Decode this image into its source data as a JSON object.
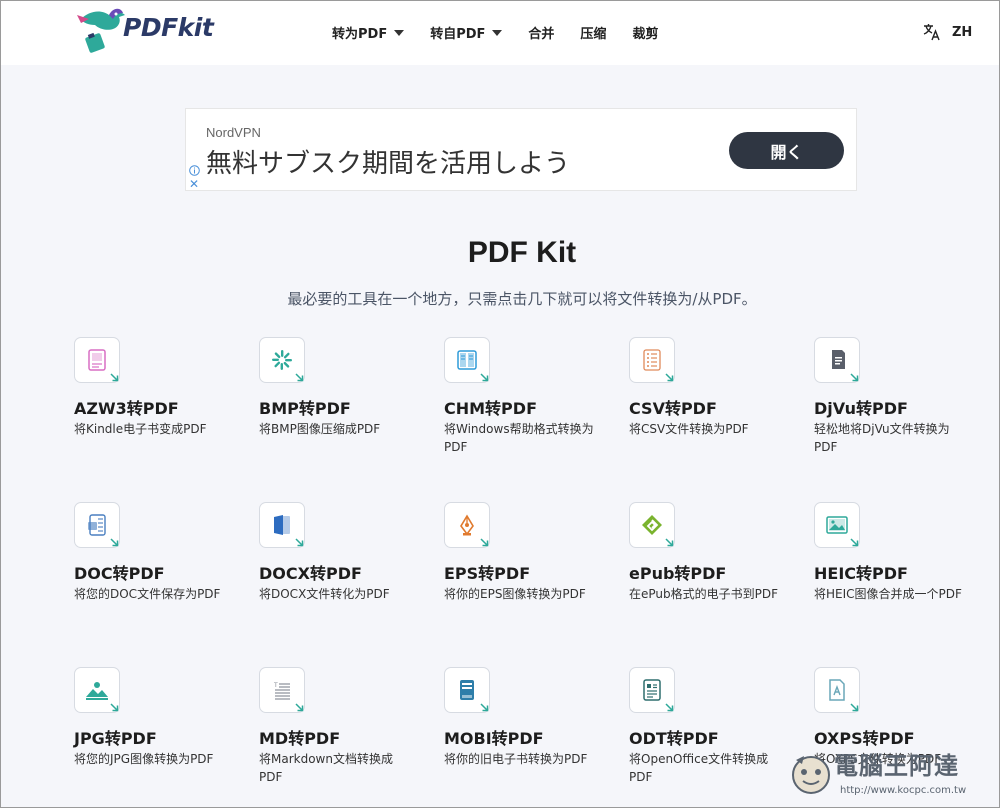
{
  "header": {
    "logo_text": "PDFkit",
    "nav": [
      {
        "label": "转为PDF",
        "dropdown": true
      },
      {
        "label": "转自PDF",
        "dropdown": true
      },
      {
        "label": "合并",
        "dropdown": false
      },
      {
        "label": "压缩",
        "dropdown": false
      },
      {
        "label": "裁剪",
        "dropdown": false
      }
    ],
    "language": "ZH"
  },
  "ad": {
    "brand": "NordVPN",
    "headline": "無料サブスク期間を活用しよう",
    "cta": "開く",
    "close": "✕"
  },
  "main": {
    "title": "PDF Kit",
    "subtitle": "最必要的工具在一个地方，只需点击几下就可以将文件转换为/从PDF。",
    "tools": [
      {
        "name": "AZW3转PDF",
        "desc": "将Kindle电子书变成PDF",
        "icon": "azw3-icon",
        "color": "#d86fc4"
      },
      {
        "name": "BMP转PDF",
        "desc": "将BMP图像压缩成PDF",
        "icon": "bmp-icon",
        "color": "#2ea99a"
      },
      {
        "name": "CHM转PDF",
        "desc": "将Windows帮助格式转换为PDF",
        "icon": "chm-icon",
        "color": "#2f9bd8"
      },
      {
        "name": "CSV转PDF",
        "desc": "将CSV文件转换为PDF",
        "icon": "csv-icon",
        "color": "#e08a5a"
      },
      {
        "name": "DjVu转PDF",
        "desc": "轻松地将DjVu文件转换为PDF",
        "icon": "djvu-icon",
        "color": "#5a5f6a"
      },
      {
        "name": "DOC转PDF",
        "desc": "将您的DOC文件保存为PDF",
        "icon": "doc-icon",
        "color": "#4a7fc0"
      },
      {
        "name": "DOCX转PDF",
        "desc": "将DOCX文件转化为PDF",
        "icon": "docx-icon",
        "color": "#2d6cc0"
      },
      {
        "name": "EPS转PDF",
        "desc": "将你的EPS图像转换为PDF",
        "icon": "eps-icon",
        "color": "#e07a2e"
      },
      {
        "name": "ePub转PDF",
        "desc": "在ePub格式的电子书到PDF",
        "icon": "epub-icon",
        "color": "#7ab32e"
      },
      {
        "name": "HEIC转PDF",
        "desc": "将HEIC图像合并成一个PDF",
        "icon": "heic-icon",
        "color": "#2ea99a"
      },
      {
        "name": "JPG转PDF",
        "desc": "将您的JPG图像转换为PDF",
        "icon": "jpg-icon",
        "color": "#2ea99a"
      },
      {
        "name": "MD转PDF",
        "desc": "将Markdown文档转换成PDF",
        "icon": "md-icon",
        "color": "#8a8f98"
      },
      {
        "name": "MOBI转PDF",
        "desc": "将你的旧电子书转换为PDF",
        "icon": "mobi-icon",
        "color": "#2e7ea9"
      },
      {
        "name": "ODT转PDF",
        "desc": "将OpenOffice文件转换成PDF",
        "icon": "odt-icon",
        "color": "#2e6e6e"
      },
      {
        "name": "OXPS转PDF",
        "desc": "将OXPS文件转换为PDF",
        "icon": "oxps-icon",
        "color": "#6aa7b8"
      }
    ]
  },
  "watermark": {
    "title": "電腦王阿達",
    "url": "http://www.kocpc.com.tw"
  },
  "colors": {
    "arrow": "#2ea99a",
    "background": "#f5f6fa",
    "cta": "#2f3642"
  }
}
